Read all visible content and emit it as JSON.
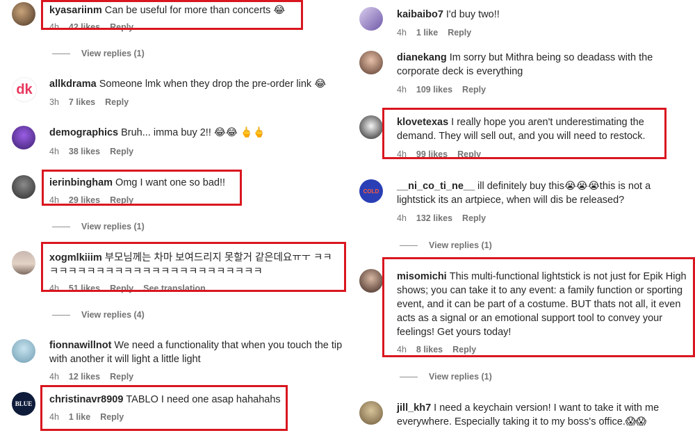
{
  "left": [
    {
      "user": "kyasariinm",
      "text": "Can be useful for more than concerts 😂",
      "time": "4h",
      "likes": "42 likes",
      "reply": "Reply"
    },
    {
      "view_replies": "View replies (1)"
    },
    {
      "user": "allkdrama",
      "text": "Someone lmk when they drop the pre-order link 😂",
      "time": "3h",
      "likes": "7 likes",
      "reply": "Reply"
    },
    {
      "user": "demographics",
      "text": "Bruh... imma buy 2!! 😂😂 🖕🖕",
      "time": "4h",
      "likes": "38 likes",
      "reply": "Reply"
    },
    {
      "user": "ierinbingham",
      "text": "Omg I want one so bad!!",
      "time": "4h",
      "likes": "29 likes",
      "reply": "Reply"
    },
    {
      "view_replies": "View replies (1)"
    },
    {
      "user": "xogmlkiiim",
      "text": "부모님께는 차마 보여드리지 못할거 같은데요ㅠㅜ ㅋㅋㅋㅋㅋㅋㅋㅋㅋㅋㅋㅋㅋㅋㅋㅋㅋㅋㅋㅋㅋㅋㅋㅋㅋ",
      "time": "4h",
      "likes": "51 likes",
      "reply": "Reply",
      "translate": "See translation"
    },
    {
      "view_replies": "View replies (4)"
    },
    {
      "user": "fionnawillnot",
      "text": "We need a functionality that when you touch the tip with another it will light a little light",
      "time": "4h",
      "likes": "12 likes",
      "reply": "Reply"
    },
    {
      "user": "christinavr8909",
      "text": "TABLO I need one asap hahahahs",
      "time": "4h",
      "likes": "1 like",
      "reply": "Reply"
    }
  ],
  "right": [
    {
      "user": "kaibaibo7",
      "text": "I'd buy two!!",
      "time": "4h",
      "likes": "1 like",
      "reply": "Reply"
    },
    {
      "user": "dianekang",
      "text": "Im sorry but Mithra being so deadass with the corporate deck is everything",
      "time": "4h",
      "likes": "109 likes",
      "reply": "Reply"
    },
    {
      "user": "klovetexas",
      "text": "I really hope you aren't underestimating the demand. They will sell out, and you will need to restock.",
      "time": "4h",
      "likes": "99 likes",
      "reply": "Reply"
    },
    {
      "user": "__ni_co_ti_ne__",
      "text": "ill definitely buy this😭😭😭this is not a lightstick its an artpiece, when will dis be released?",
      "time": "4h",
      "likes": "132 likes",
      "reply": "Reply"
    },
    {
      "view_replies": "View replies (1)"
    },
    {
      "user": "misomichi",
      "text": "This multi-functional lightstick is not just for Epik High shows; you can take it to any event: a family function or sporting event, and it can be part of a costume. BUT thats not all, it even acts as a signal or an emotional support tool to convey your feelings! Get yours today!",
      "time": "4h",
      "likes": "8 likes",
      "reply": "Reply"
    },
    {
      "view_replies": "View replies (1)"
    },
    {
      "user": "jill_kh7",
      "text": "I need a keychain version! I want to take it with me everywhere. Especially taking it to my boss's office.😱😱",
      "time": "",
      "likes": "",
      "reply": ""
    }
  ],
  "avatar_labels": {
    "allkdrama": "dk",
    "christinavr8909": "BLUE",
    "__ni_co_ti_ne__": "COLD"
  },
  "colors": {
    "highlight": "#d9161f",
    "meta": "#737373",
    "text": "#262626"
  }
}
